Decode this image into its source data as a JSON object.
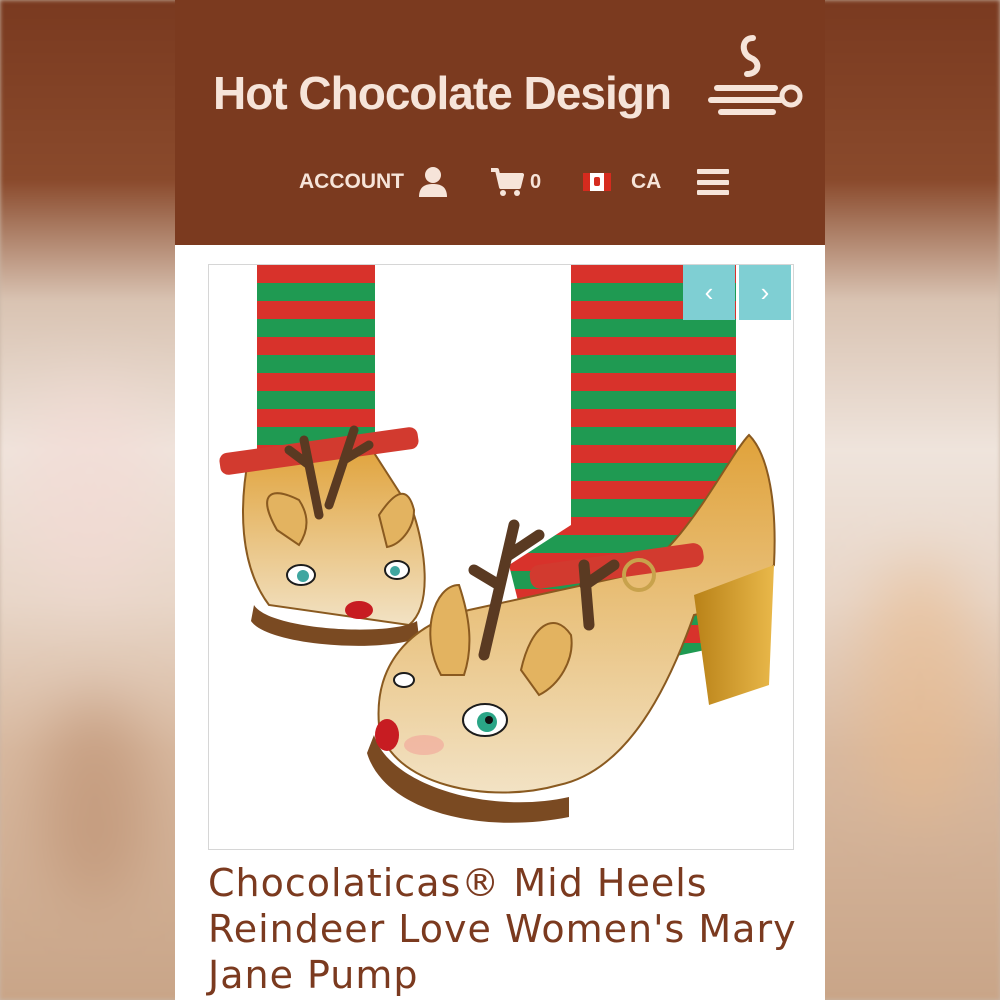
{
  "header": {
    "logo_text": "Hot Chocolate Design",
    "brand_color": "#7b3a1f",
    "logo_color": "#f6e4d9"
  },
  "nav": {
    "account_label": "ACCOUNT",
    "account_icon": "user-icon",
    "cart_icon": "cart-icon",
    "cart_count": "0",
    "locale_flag": "canada-flag-icon",
    "locale_label": "CA",
    "menu_icon": "hamburger-menu-icon"
  },
  "carousel": {
    "prev_label": "‹",
    "next_label": "›",
    "button_color": "#7fcfd3",
    "image_subject": "reindeer-mary-jane-pump-photo"
  },
  "product": {
    "title": "Chocolaticas® Mid Heels Reindeer Love Women's Mary Jane Pump"
  }
}
